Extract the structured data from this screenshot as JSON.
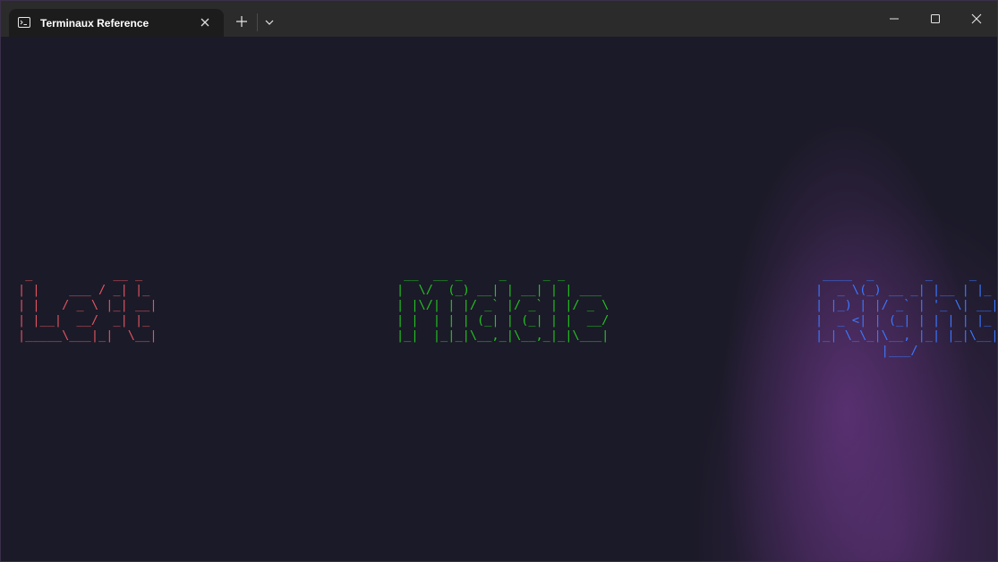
{
  "window": {
    "tab_title": "Terminaux Reference",
    "icons": {
      "tab": "terminal-icon",
      "close_tab": "close-icon",
      "new_tab": "plus-icon",
      "dropdown": "chevron-down-icon",
      "minimize": "minimize-icon",
      "maximize": "maximize-icon",
      "close_window": "close-icon"
    }
  },
  "terminal": {
    "left": {
      "lines": [
        " _           __ _   ",
        "| |    ___ / _| |_ ",
        "| |   / _ \\ |_| __|",
        "| |__|  __/  _| |_ ",
        "|_____\\___|_|  \\__|"
      ],
      "color": "#e05561"
    },
    "middle": {
      "lines": [
        " __  __ _     _     _ _       ",
        "|  \\/  (_) __| | __| | | ___ ",
        "| |\\/| | |/ _` |/ _` | |/ _ \\",
        "| |  | | | (_| | (_| | |  __/",
        "|_|  |_|_|\\__,_|\\__,_|_|\\___|"
      ],
      "color": "#22c322"
    },
    "right": {
      "lines": [
        " ____  _       _     _   ",
        "|  _ \\(_) __ _| |__ | |_ ",
        "| |_) | |/ _` | '_ \\| __|",
        "|  _ <| | (_| | | | | |_ ",
        "|_| \\_\\_|\\__, |_| |_|\\__|",
        "         |___/           "
      ],
      "color": "#3b78ff"
    }
  },
  "colors": {
    "titlebar": "#2b2b2b",
    "tab_active": "#1c1c1c",
    "terminal_bg": "#1b1a28"
  }
}
